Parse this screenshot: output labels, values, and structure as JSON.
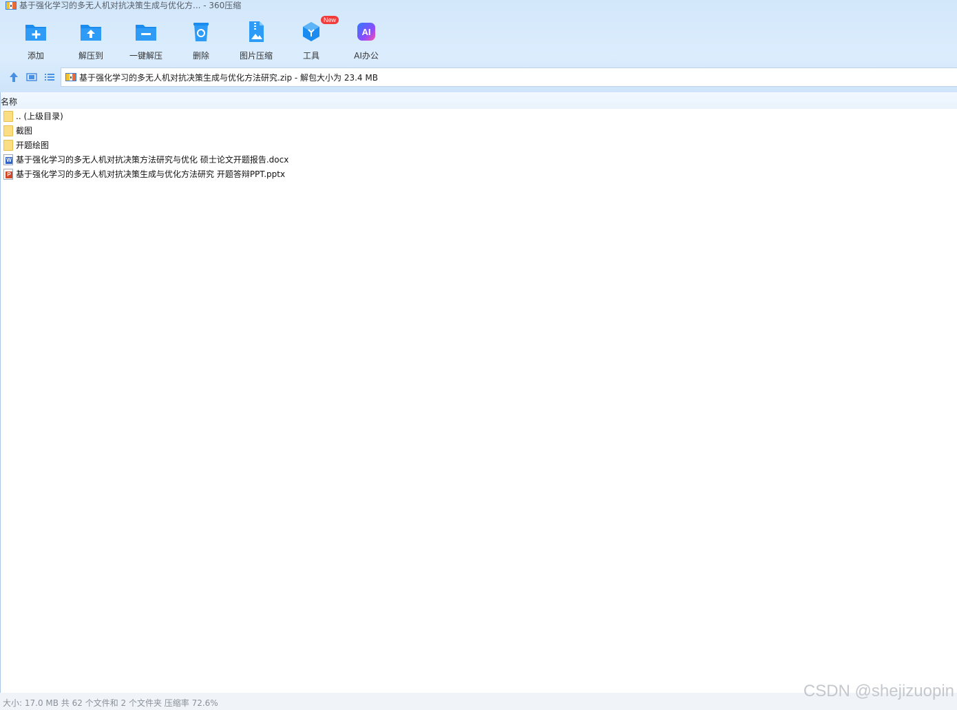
{
  "window": {
    "title": "基于强化学习的多无人机对抗决策生成与优化方... - 360压缩"
  },
  "toolbar": {
    "add": "添加",
    "extract_to": "解压到",
    "one_click_extract": "一键解压",
    "delete": "删除",
    "image_compress": "图片压缩",
    "tools": "工具",
    "tools_badge": "New",
    "ai_office": "AI办公",
    "ai_glyph": "AI"
  },
  "address": {
    "text": "基于强化学习的多无人机对抗决策生成与优化方法研究.zip - 解包大小为 23.4 MB"
  },
  "list": {
    "column_name": "名称",
    "rows": [
      {
        "type": "folder",
        "name": ".. (上级目录)"
      },
      {
        "type": "folder",
        "name": "截图"
      },
      {
        "type": "folder",
        "name": "开题绘图"
      },
      {
        "type": "docx",
        "name": "基于强化学习的多无人机对抗决策方法研究与优化 硕士论文开题报告.docx",
        "badge": "W"
      },
      {
        "type": "pptx",
        "name": "基于强化学习的多无人机对抗决策生成与优化方法研究 开题答辩PPT.pptx",
        "badge": "P"
      }
    ]
  },
  "status": {
    "text": "大小: 17.0 MB 共 62 个文件和 2 个文件夹 压缩率 72.6%"
  },
  "watermark": "CSDN @shejizuopin",
  "colors": {
    "accent": "#1a8cf0",
    "folder": "#fbde83",
    "word": "#2f62c9",
    "powerpoint": "#d24726",
    "badge": "#f23b3b"
  }
}
